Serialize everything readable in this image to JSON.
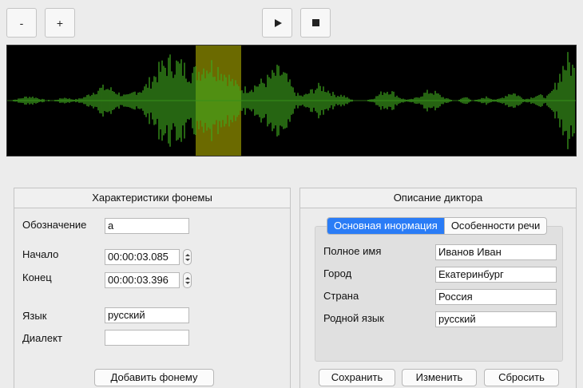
{
  "toolbar": {
    "zoom_out_label": "-",
    "zoom_in_label": "+",
    "play_icon": "play-icon",
    "stop_icon": "stop-icon"
  },
  "waveform": {
    "background_color": "#000000",
    "wave_color": "#3fa81f",
    "selection_color": "#6b6a00",
    "selection": {
      "start": "00:00:03.085",
      "end": "00:00:03.396"
    }
  },
  "phoneme_panel": {
    "title": "Характеристики фонемы",
    "designation_label": "Обозначение",
    "designation_value": "а",
    "start_label": "Начало",
    "start_value": "00:00:03.085",
    "end_label": "Конец",
    "end_value": "00:00:03.396",
    "language_label": "Язык",
    "language_value": "русский",
    "dialect_label": "Диалект",
    "dialect_value": "",
    "add_button": "Добавить фонему"
  },
  "speaker_panel": {
    "title": "Описание диктора",
    "tabs": [
      {
        "label": "Основная инормация",
        "active": true
      },
      {
        "label": "Особенности речи",
        "active": false
      }
    ],
    "full_name_label": "Полное имя",
    "full_name_value": "Иванов Иван",
    "city_label": "Город",
    "city_value": "Екатеринбург",
    "country_label": "Страна",
    "country_value": "Россия",
    "native_language_label": "Родной язык",
    "native_language_value": "русский",
    "save_button": "Сохранить",
    "edit_button": "Изменить",
    "reset_button": "Сбросить"
  }
}
